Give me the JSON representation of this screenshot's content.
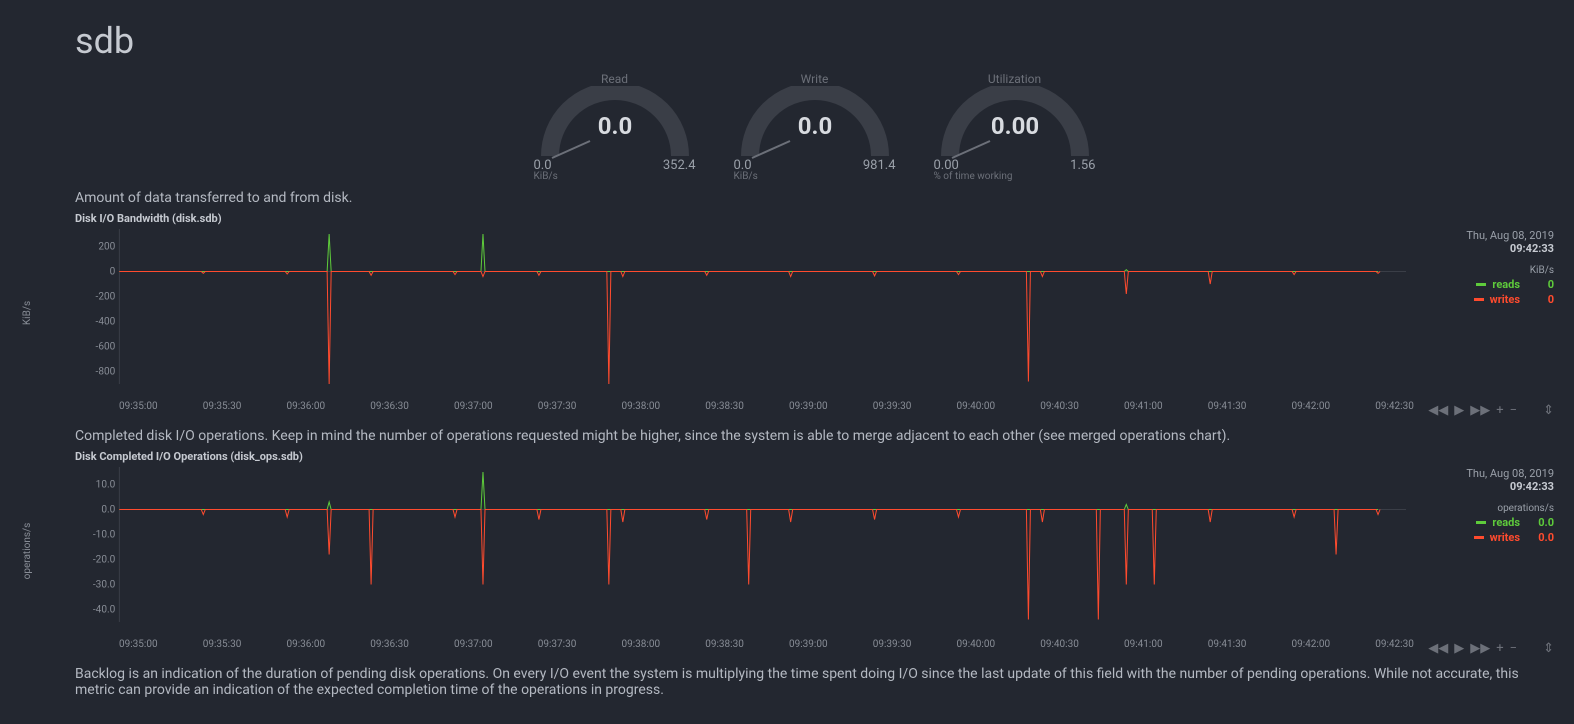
{
  "title": "sdb",
  "gauges": [
    {
      "label": "Read",
      "value": "0.0",
      "min": "0.0",
      "max": "352.4",
      "units": "KiB/s"
    },
    {
      "label": "Write",
      "value": "0.0",
      "min": "0.0",
      "max": "981.4",
      "units": "KiB/s"
    },
    {
      "label": "Utilization",
      "value": "0.00",
      "min": "0.00",
      "max": "1.56",
      "units": "% of time working"
    }
  ],
  "descriptions": {
    "bandwidth": "Amount of data transferred to and from disk.",
    "ops": "Completed disk I/O operations. Keep in mind the number of operations requested might be higher, since the system is able to merge adjacent to each other (see merged operations chart).",
    "backlog": "Backlog is an indication of the duration of pending disk operations. On every I/O event the system is multiplying the time spent doing I/O since the last update of this field with the number of pending operations. While not accurate, this metric can provide an indication of the expected completion time of the operations in progress."
  },
  "charts": {
    "bandwidth": {
      "title": "Disk I/O Bandwidth (disk.sdb)",
      "ylabel": "KiB/s",
      "date": "Thu, Aug 08, 2019",
      "time": "09:42:33",
      "units": "KiB/s",
      "legend": {
        "reads": "reads",
        "writes": "writes",
        "reads_val": "0",
        "writes_val": "0"
      }
    },
    "ops": {
      "title": "Disk Completed I/O Operations (disk_ops.sdb)",
      "ylabel": "operations/s",
      "date": "Thu, Aug 08, 2019",
      "time": "09:42:33",
      "units": "operations/s",
      "legend": {
        "reads": "reads",
        "writes": "writes",
        "reads_val": "0.0",
        "writes_val": "0.0"
      }
    }
  },
  "x_ticks": [
    "09:35:00",
    "09:35:30",
    "09:36:00",
    "09:36:30",
    "09:37:00",
    "09:37:30",
    "09:38:00",
    "09:38:30",
    "09:39:00",
    "09:39:30",
    "09:40:00",
    "09:40:30",
    "09:41:00",
    "09:41:30",
    "09:42:00",
    "09:42:30"
  ],
  "chart_data": [
    {
      "type": "line",
      "title": "Disk I/O Bandwidth (disk.sdb)",
      "xlabel": "",
      "ylabel": "KiB/s",
      "ylim": [
        -900,
        300
      ],
      "y_ticks": [
        200,
        0,
        -200,
        -400,
        -600,
        -800
      ],
      "x": [
        "09:35:00",
        "09:35:30",
        "09:36:00",
        "09:36:15",
        "09:36:30",
        "09:37:00",
        "09:37:10",
        "09:37:30",
        "09:37:55",
        "09:38:00",
        "09:38:30",
        "09:39:00",
        "09:39:30",
        "09:40:00",
        "09:40:25",
        "09:40:30",
        "09:41:00",
        "09:41:30",
        "09:42:00",
        "09:42:30"
      ],
      "series": [
        {
          "name": "reads",
          "values": [
            0,
            0,
            0,
            300,
            0,
            0,
            300,
            0,
            0,
            0,
            0,
            0,
            0,
            0,
            0,
            0,
            15,
            0,
            0,
            0
          ]
        },
        {
          "name": "writes",
          "values": [
            0,
            -15,
            -20,
            -900,
            -30,
            -25,
            -40,
            -30,
            -900,
            -40,
            -30,
            -40,
            -35,
            -25,
            -880,
            -40,
            -180,
            -100,
            -25,
            -15
          ]
        }
      ]
    },
    {
      "type": "line",
      "title": "Disk Completed I/O Operations (disk_ops.sdb)",
      "xlabel": "",
      "ylabel": "operations/s",
      "ylim": [
        -45,
        15
      ],
      "y_ticks": [
        10,
        0,
        -10,
        -20,
        -30,
        -40
      ],
      "x": [
        "09:35:00",
        "09:35:30",
        "09:36:00",
        "09:36:15",
        "09:36:30",
        "09:37:00",
        "09:37:10",
        "09:37:30",
        "09:37:55",
        "09:38:00",
        "09:38:30",
        "09:38:45",
        "09:39:00",
        "09:39:30",
        "09:40:00",
        "09:40:25",
        "09:40:30",
        "09:40:50",
        "09:41:00",
        "09:41:10",
        "09:41:30",
        "09:42:00",
        "09:42:15",
        "09:42:30"
      ],
      "series": [
        {
          "name": "reads",
          "values": [
            0,
            0,
            0,
            3,
            0,
            0,
            15,
            0,
            0,
            0,
            0,
            0,
            0,
            0,
            0,
            0,
            0,
            0,
            2,
            0,
            0,
            0,
            0,
            0
          ]
        },
        {
          "name": "writes",
          "values": [
            0,
            -2,
            -3,
            -18,
            -30,
            -3,
            -30,
            -4,
            -30,
            -5,
            -4,
            -30,
            -5,
            -4,
            -3,
            -44,
            -5,
            -44,
            -30,
            -30,
            -5,
            -3,
            -18,
            -2
          ]
        }
      ]
    }
  ]
}
